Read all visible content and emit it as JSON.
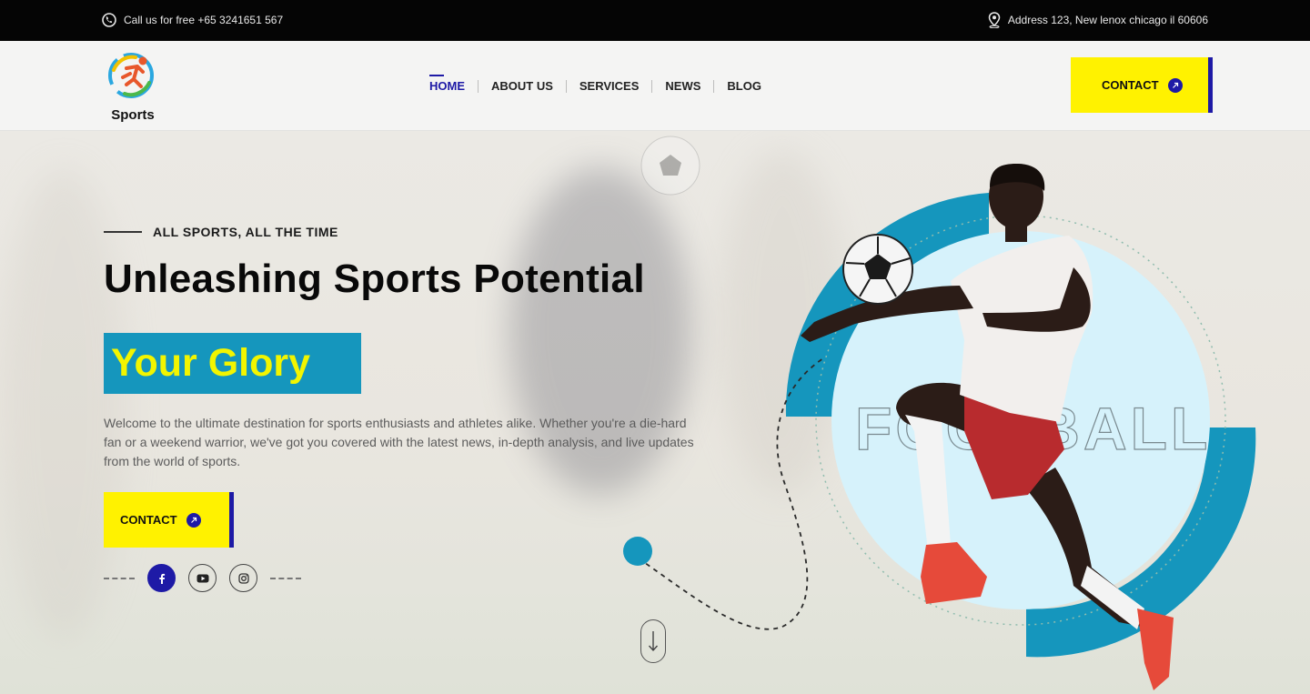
{
  "topbar": {
    "phone_text": "Call us for free +65 3241651 567",
    "address_text": "Address 123, New lenox chicago il 60606",
    "phone_icon": "phone-icon",
    "address_icon": "location-pin-icon"
  },
  "header": {
    "logo_text": "Sports",
    "nav": [
      "HOME",
      "ABOUT US",
      "SERVICES",
      "NEWS",
      "BLOG"
    ],
    "active_nav": "HOME",
    "contact_label": "CONTACT"
  },
  "hero": {
    "eyebrow": "ALL SPORTS, ALL THE TIME",
    "headline": "Unleashing Sports Potential",
    "highlight": "Your Glory",
    "description": "Welcome to the ultimate destination for sports enthusiasts and athletes alike. Whether you're a die-hard fan or a weekend warrior, we've got you covered with the latest news, in-depth analysis, and live updates from the world of sports.",
    "contact_label": "CONTACT",
    "socials": [
      "facebook-icon",
      "youtube-icon",
      "instagram-icon"
    ],
    "outline_word": "FOOTBALL"
  },
  "colors": {
    "accent_blue": "#1e1aa6",
    "accent_yellow": "#fff200",
    "teal": "#1596bd",
    "light_cyan": "#d6f2fb",
    "topbar_bg": "#050505"
  }
}
